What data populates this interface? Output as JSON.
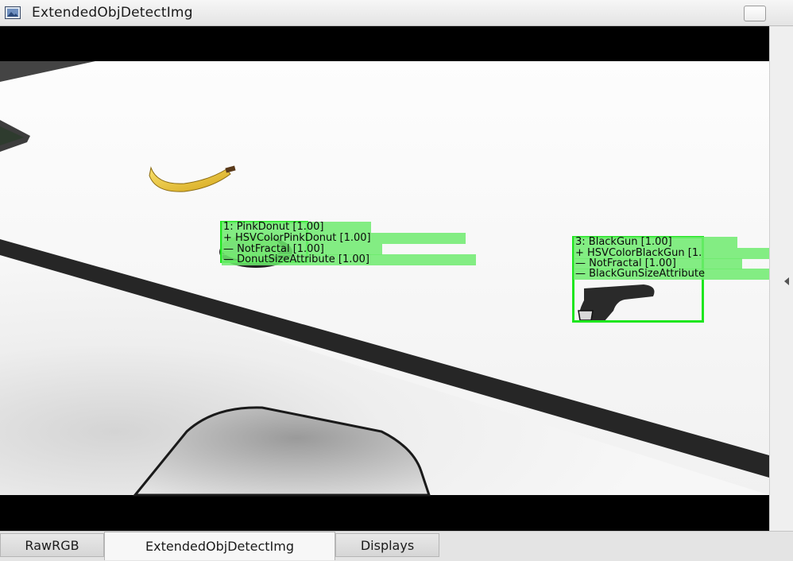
{
  "window": {
    "title": "ExtendedObjDetectImg",
    "icon": "image-icon"
  },
  "detections": [
    {
      "header": "1: PinkDonut  [1.00]",
      "attributes": [
        "+  HSVColorPinkDonut  [1.00]",
        "—  NotFractal  [1.00]",
        "—  DonutSizeAttribute  [1.00]"
      ]
    },
    {
      "header": "3: BlackGun  [1.00]",
      "attributes": [
        "+  HSVColorBlackGun  [1.",
        "—  NotFractal  [1.00]",
        "—  BlackGunSizeAttribute"
      ]
    }
  ],
  "tabs": [
    {
      "label": "RawRGB",
      "active": false
    },
    {
      "label": "ExtendedObjDetectImg",
      "active": true
    },
    {
      "label": "Displays",
      "active": false
    }
  ],
  "colors": {
    "detection_box": "#1ee61e",
    "detection_label_bg": "#6eeb6e"
  }
}
